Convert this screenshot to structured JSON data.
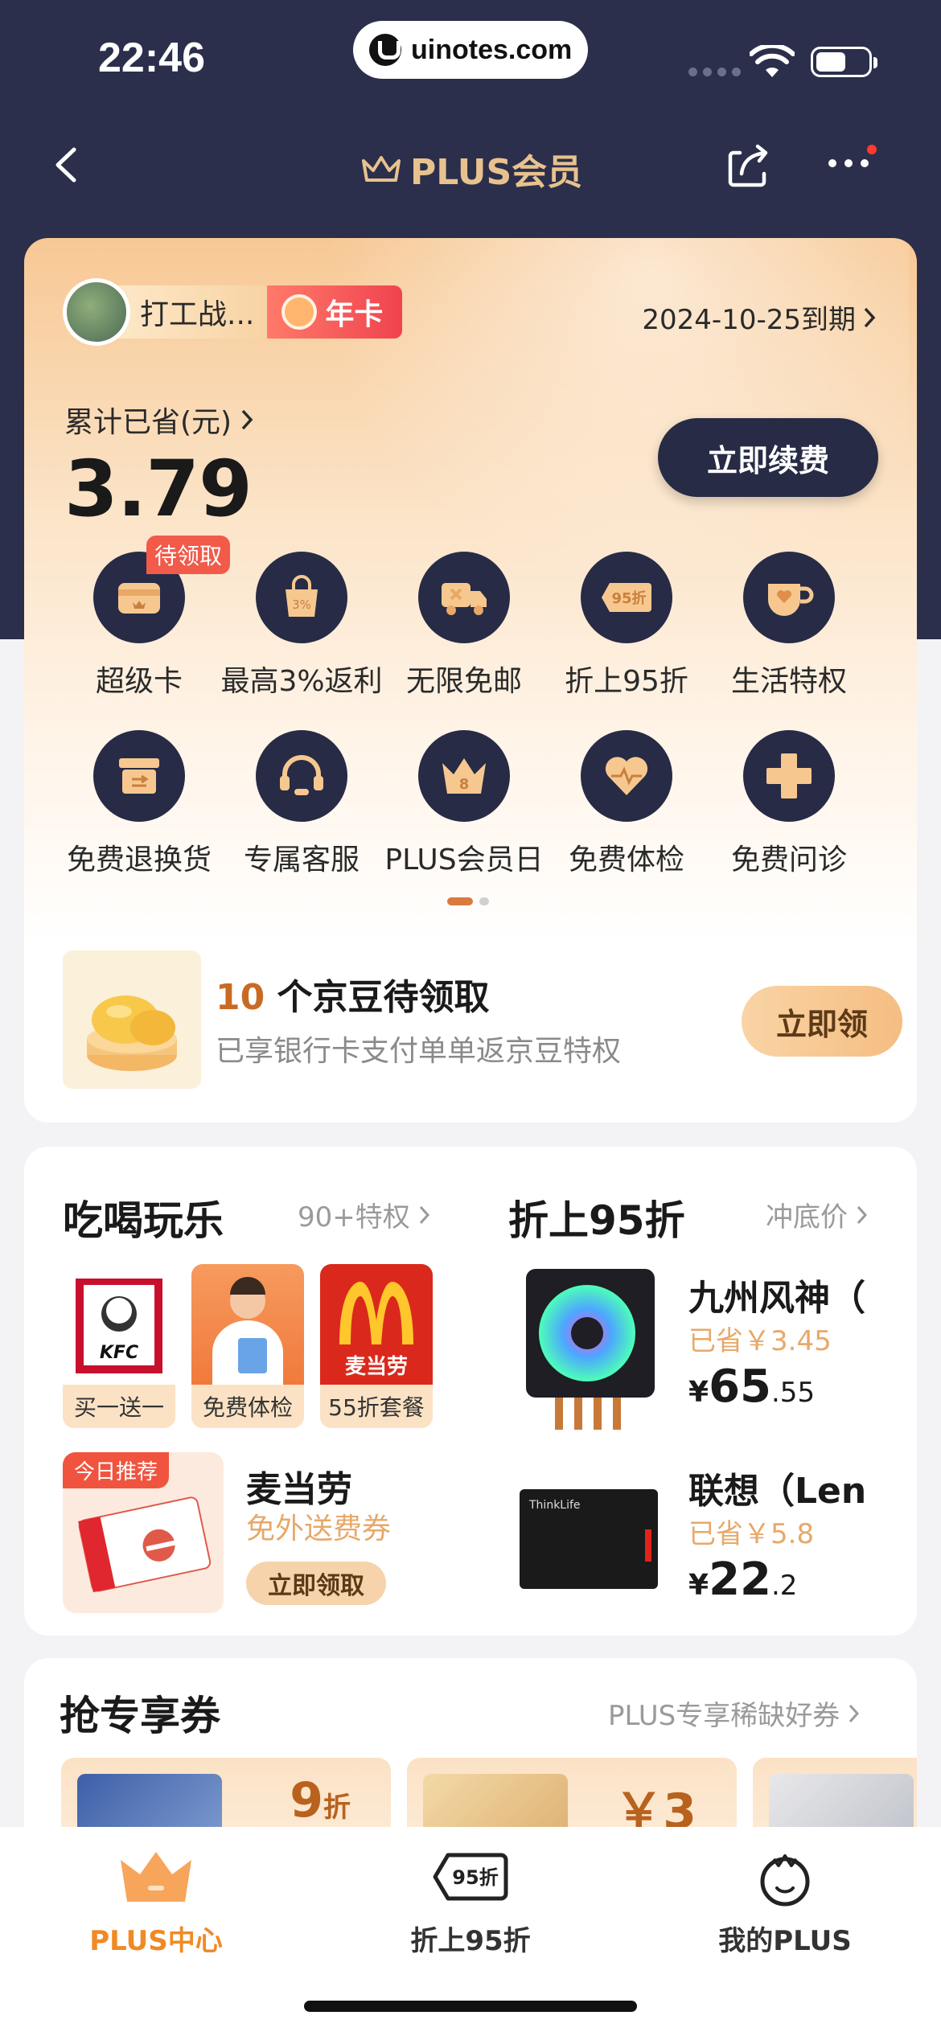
{
  "status_bar": {
    "time": "22:46",
    "url": "uinotes.com"
  },
  "nav": {
    "title": "PLUS会员"
  },
  "member": {
    "name": "打工战...",
    "badge": "年卡",
    "expiry": "2024-10-25到期",
    "saved_label": "累计已省(元)",
    "saved_value": "3.79",
    "renew_button": "立即续费"
  },
  "benefits": {
    "pending_tag": "待领取",
    "row1": [
      "超级卡",
      "最高3%返利",
      "无限免邮",
      "折上95折",
      "生活特权"
    ],
    "row2": [
      "免费退换货",
      "专属客服",
      "PLUS会员日",
      "免费体检",
      "免费问诊"
    ],
    "icons_row1": [
      "card-icon",
      "shopping-bag-icon",
      "truck-icon",
      "discount-tag-icon",
      "cup-icon"
    ],
    "icons_row2": [
      "return-box-icon",
      "headset-icon",
      "crown-icon",
      "heart-icon",
      "medical-cross-icon"
    ]
  },
  "beans": {
    "count": "10",
    "title_rest": " 个京豆待领取",
    "subtitle": "已享银行卡支付单单返京豆特权",
    "button": "立即领"
  },
  "food": {
    "title": "吃喝玩乐",
    "more": "90+特权",
    "tiles": [
      "买一送一",
      "免费体检",
      "55折套餐"
    ],
    "kfc_text": "KFC",
    "mcd_text": "麦当劳",
    "recommend_tag": "今日推荐",
    "recommend_title": "麦当劳",
    "recommend_sub": "免外送费券",
    "recommend_button": "立即领取"
  },
  "discount": {
    "title": "折上95折",
    "more": "冲底价",
    "products": [
      {
        "name": "九州风神（",
        "saved": "已省￥3.45",
        "currency": "¥",
        "int": "65",
        "dec": ".55"
      },
      {
        "name": "联想（Len",
        "saved": "已省￥5.8",
        "currency": "¥",
        "int": "22",
        "dec": ".2"
      }
    ]
  },
  "coupons": {
    "title": "抢专享券",
    "more": "PLUS专享稀缺好券",
    "items": [
      {
        "value": "9",
        "unit": "折"
      },
      {
        "value": "￥3",
        "unit": ""
      }
    ]
  },
  "tabbar": {
    "items": [
      "PLUS中心",
      "折上95折",
      "我的PLUS"
    ],
    "active_color": "#f08a24"
  }
}
